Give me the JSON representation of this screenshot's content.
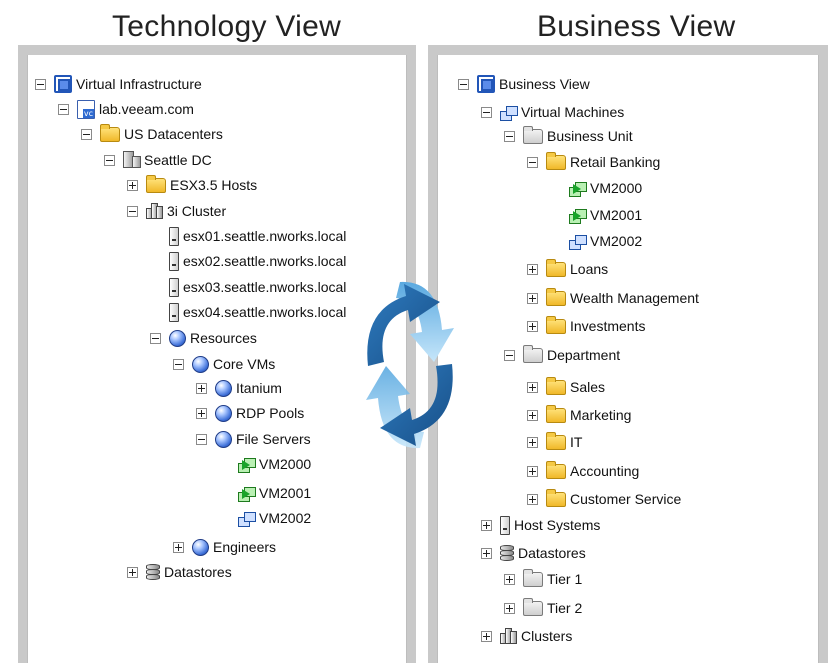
{
  "headers": {
    "left": "Technology View",
    "right": "Business View"
  },
  "technology_tree": [
    {
      "label": "Virtual Infrastructure",
      "level": 0,
      "expander": "minus",
      "icon": "virtual-infrastructure-icon"
    },
    {
      "label": "lab.veeam.com",
      "level": 1,
      "expander": "minus",
      "icon": "vcenter-icon"
    },
    {
      "label": "US Datacenters",
      "level": 2,
      "expander": "minus",
      "icon": "folder-icon"
    },
    {
      "label": "Seattle DC",
      "level": 3,
      "expander": "minus",
      "icon": "datacenter-icon"
    },
    {
      "label": "ESX3.5 Hosts",
      "level": 4,
      "expander": "plus",
      "icon": "folder-icon"
    },
    {
      "label": "3i Cluster",
      "level": 4,
      "expander": "minus",
      "icon": "cluster-icon"
    },
    {
      "label": "esx01.seattle.nworks.local",
      "level": 5,
      "expander": "none",
      "icon": "host-icon"
    },
    {
      "label": "esx02.seattle.nworks.local",
      "level": 5,
      "expander": "none",
      "icon": "host-icon"
    },
    {
      "label": "esx03.seattle.nworks.local",
      "level": 5,
      "expander": "none",
      "icon": "host-icon"
    },
    {
      "label": "esx04.seattle.nworks.local",
      "level": 5,
      "expander": "none",
      "icon": "host-icon"
    },
    {
      "label": "Resources",
      "level": 5,
      "expander": "minus",
      "icon": "resource-pool-icon"
    },
    {
      "label": "Core VMs",
      "level": 6,
      "expander": "minus",
      "icon": "resource-pool-icon"
    },
    {
      "label": "Itanium",
      "level": 7,
      "expander": "plus",
      "icon": "resource-pool-icon"
    },
    {
      "label": "RDP Pools",
      "level": 7,
      "expander": "plus",
      "icon": "resource-pool-icon"
    },
    {
      "label": "File Servers",
      "level": 7,
      "expander": "minus",
      "icon": "resource-pool-icon"
    },
    {
      "label": "VM2000",
      "level": 8,
      "expander": "none",
      "icon": "vm-running-icon"
    },
    {
      "label": "VM2001",
      "level": 8,
      "expander": "none",
      "icon": "vm-running-icon"
    },
    {
      "label": "VM2002",
      "level": 8,
      "expander": "none",
      "icon": "vm-icon"
    },
    {
      "label": "Engineers",
      "level": 6,
      "expander": "plus",
      "icon": "resource-pool-icon"
    },
    {
      "label": "Datastores",
      "level": 4,
      "expander": "plus",
      "icon": "datastore-icon"
    }
  ],
  "business_tree": [
    {
      "label": "Business View",
      "level": 0,
      "expander": "minus",
      "icon": "virtual-infrastructure-icon"
    },
    {
      "label": "Virtual Machines",
      "level": 1,
      "expander": "minus",
      "icon": "vm-icon"
    },
    {
      "label": "Business Unit",
      "level": 2,
      "expander": "minus",
      "icon": "grey-folder-icon"
    },
    {
      "label": "Retail Banking",
      "level": 3,
      "expander": "minus",
      "icon": "folder-icon"
    },
    {
      "label": "VM2000",
      "level": 4,
      "expander": "none",
      "icon": "vm-running-icon"
    },
    {
      "label": "VM2001",
      "level": 4,
      "expander": "none",
      "icon": "vm-running-icon"
    },
    {
      "label": "VM2002",
      "level": 4,
      "expander": "none",
      "icon": "vm-icon"
    },
    {
      "label": "Loans",
      "level": 3,
      "expander": "plus",
      "icon": "folder-icon"
    },
    {
      "label": "Wealth Management",
      "level": 3,
      "expander": "plus",
      "icon": "folder-icon"
    },
    {
      "label": "Investments",
      "level": 3,
      "expander": "plus",
      "icon": "folder-icon"
    },
    {
      "label": "Department",
      "level": 2,
      "expander": "minus",
      "icon": "grey-folder-icon"
    },
    {
      "label": "Sales",
      "level": 3,
      "expander": "plus",
      "icon": "folder-icon"
    },
    {
      "label": "Marketing",
      "level": 3,
      "expander": "plus",
      "icon": "folder-icon"
    },
    {
      "label": "IT",
      "level": 3,
      "expander": "plus",
      "icon": "folder-icon"
    },
    {
      "label": "Accounting",
      "level": 3,
      "expander": "plus",
      "icon": "folder-icon"
    },
    {
      "label": "Customer Service",
      "level": 3,
      "expander": "plus",
      "icon": "folder-icon"
    },
    {
      "label": "Host Systems",
      "level": 1,
      "expander": "plus",
      "icon": "host-icon"
    },
    {
      "label": "Datastores",
      "level": 1,
      "expander": "plus",
      "icon": "datastore-icon"
    },
    {
      "label": "Tier 1",
      "level": 2,
      "expander": "plus",
      "icon": "grey-folder-icon"
    },
    {
      "label": "Tier 2",
      "level": 2,
      "expander": "plus",
      "icon": "grey-folder-icon"
    },
    {
      "label": "Clusters",
      "level": 1,
      "expander": "plus",
      "icon": "cluster-icon"
    }
  ],
  "colors": {
    "panel_frame": "#c9c9c9",
    "arrow_dark": "#1f5f99",
    "arrow_light": "#86c3ea"
  }
}
